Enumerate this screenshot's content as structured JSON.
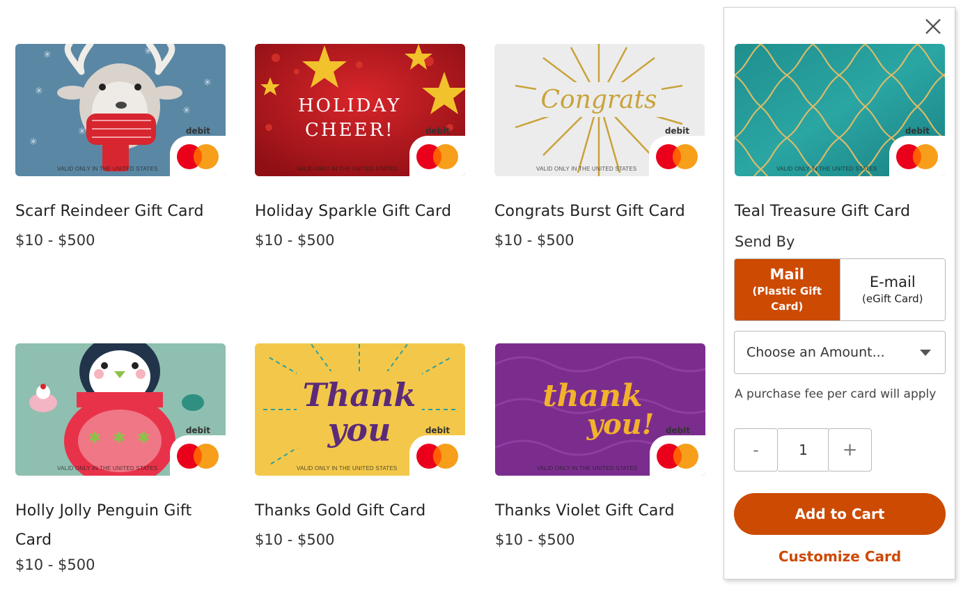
{
  "card_common": {
    "debit": "debit",
    "valid_text": "VALID ONLY IN THE UNITED STATES"
  },
  "cards": [
    {
      "title": "Scarf Reindeer Gift Card",
      "price": "$10 - $500"
    },
    {
      "title": "Holiday Sparkle Gift Card",
      "price": "$10 - $500",
      "art_text": [
        "HOLIDAY",
        "CHEER!"
      ]
    },
    {
      "title": "Congrats Burst Gift Card",
      "price": "$10 - $500",
      "art_text": "Congrats"
    },
    {
      "title": "Holly Jolly Penguin Gift Card",
      "price": "$10 - $500"
    },
    {
      "title": "Thanks Gold Gift Card",
      "price": "$10 - $500",
      "art_text": [
        "Thank",
        "you"
      ]
    },
    {
      "title": "Thanks Violet Gift Card",
      "price": "$10 - $500",
      "art_text": [
        "thank",
        "you!"
      ]
    }
  ],
  "panel": {
    "card_title": "Teal Treasure Gift Card",
    "send_by_label": "Send By",
    "send_options": [
      {
        "main": "Mail",
        "sub": "(Plastic Gift Card)",
        "selected": true
      },
      {
        "main": "E-mail",
        "sub": "(eGift Card)",
        "selected": false
      }
    ],
    "amount_placeholder": "Choose an Amount...",
    "fee_note": "A purchase fee per card will apply",
    "qty_minus": "-",
    "qty_value": "1",
    "qty_plus": "+",
    "add_to_cart": "Add to Cart",
    "customize": "Customize Card",
    "accent_color": "#cc4a02"
  }
}
